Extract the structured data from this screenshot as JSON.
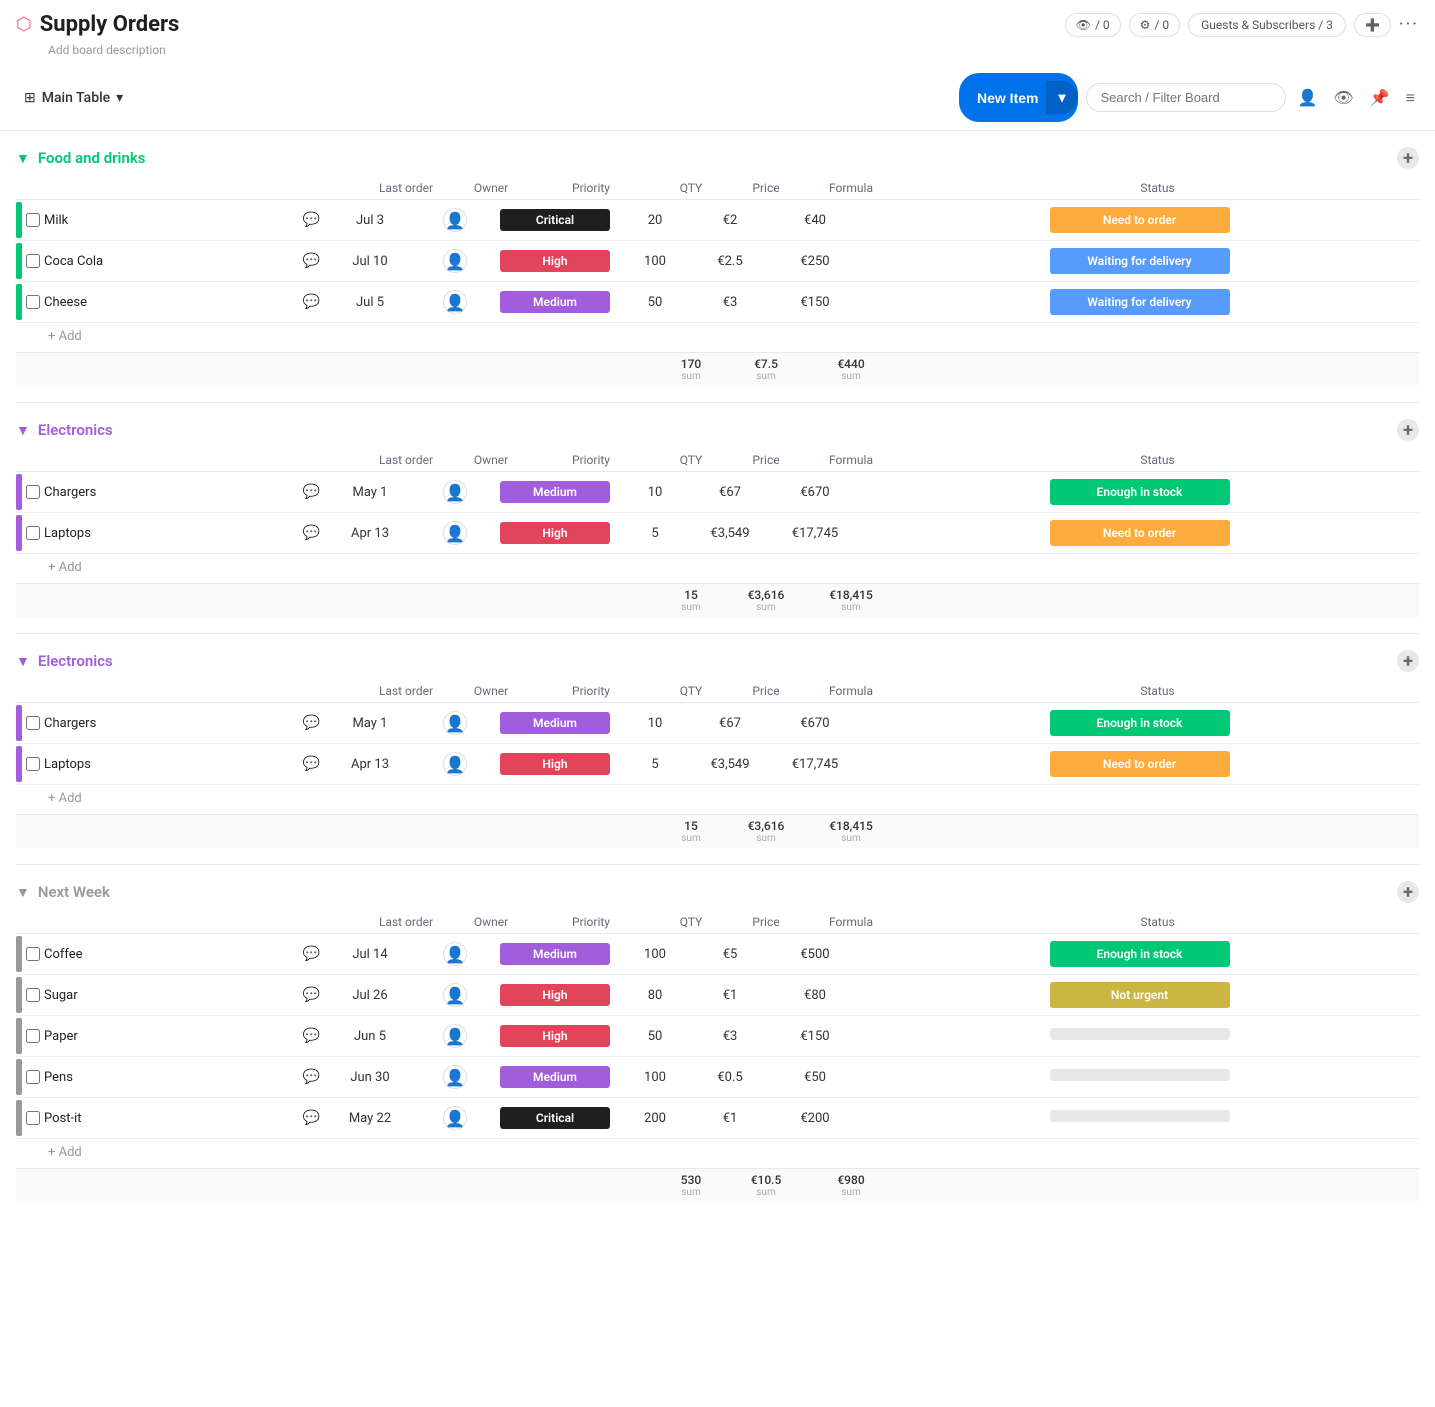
{
  "header": {
    "title": "Supply Orders",
    "description": "Add board description",
    "views_count": "0",
    "automation_count": "0",
    "guests_label": "Guests & Subscribers / 3"
  },
  "toolbar": {
    "main_table_label": "Main Table",
    "new_item_label": "New Item",
    "search_placeholder": "Search / Filter Board"
  },
  "groups": [
    {
      "id": "food",
      "title": "Food and drinks",
      "color": "green",
      "color_hex": "#00c875",
      "collapsed": false,
      "columns": [
        "Last order",
        "Owner",
        "Priority",
        "QTY",
        "Price",
        "Formula",
        "Status"
      ],
      "rows": [
        {
          "name": "Milk",
          "last_order": "Jul 3",
          "priority": "Critical",
          "priority_class": "critical",
          "qty": "20",
          "price": "€2",
          "formula": "€40",
          "status": "Need to order",
          "status_class": "orange"
        },
        {
          "name": "Coca Cola",
          "last_order": "Jul 10",
          "priority": "High",
          "priority_class": "high",
          "qty": "100",
          "price": "€2.5",
          "formula": "€250",
          "status": "Waiting for delivery",
          "status_class": "blue"
        },
        {
          "name": "Cheese",
          "last_order": "Jul 5",
          "priority": "Medium",
          "priority_class": "medium",
          "qty": "50",
          "price": "€3",
          "formula": "€150",
          "status": "Waiting for delivery",
          "status_class": "blue"
        }
      ],
      "summary": {
        "qty": "170",
        "price": "€7.5",
        "formula": "€440"
      }
    },
    {
      "id": "electronics1",
      "title": "Electronics",
      "color": "purple",
      "color_hex": "#a25ddc",
      "collapsed": false,
      "columns": [
        "Last order",
        "Owner",
        "Priority",
        "QTY",
        "Price",
        "Formula",
        "Status"
      ],
      "rows": [
        {
          "name": "Chargers",
          "last_order": "May 1",
          "priority": "Medium",
          "priority_class": "medium",
          "qty": "10",
          "price": "€67",
          "formula": "€670",
          "status": "Enough in stock",
          "status_class": "green"
        },
        {
          "name": "Laptops",
          "last_order": "Apr 13",
          "priority": "High",
          "priority_class": "high",
          "qty": "5",
          "price": "€3,549",
          "formula": "€17,745",
          "status": "Need to order",
          "status_class": "orange"
        }
      ],
      "summary": {
        "qty": "15",
        "price": "€3,616",
        "formula": "€18,415"
      }
    },
    {
      "id": "electronics2",
      "title": "Electronics",
      "color": "purple",
      "color_hex": "#a25ddc",
      "collapsed": false,
      "columns": [
        "Last order",
        "Owner",
        "Priority",
        "QTY",
        "Price",
        "Formula",
        "Status"
      ],
      "rows": [
        {
          "name": "Chargers",
          "last_order": "May 1",
          "priority": "Medium",
          "priority_class": "medium",
          "qty": "10",
          "price": "€67",
          "formula": "€670",
          "status": "Enough in stock",
          "status_class": "green"
        },
        {
          "name": "Laptops",
          "last_order": "Apr 13",
          "priority": "High",
          "priority_class": "high",
          "qty": "5",
          "price": "€3,549",
          "formula": "€17,745",
          "status": "Need to order",
          "status_class": "orange"
        }
      ],
      "summary": {
        "qty": "15",
        "price": "€3,616",
        "formula": "€18,415"
      }
    },
    {
      "id": "nextweek",
      "title": "Next Week",
      "color": "gray",
      "color_hex": "#999",
      "collapsed": false,
      "columns": [
        "Last order",
        "Owner",
        "Priority",
        "QTY",
        "Price",
        "Formula",
        "Status"
      ],
      "rows": [
        {
          "name": "Coffee",
          "last_order": "Jul 14",
          "priority": "Medium",
          "priority_class": "medium",
          "qty": "100",
          "price": "€5",
          "formula": "€500",
          "status": "Enough in stock",
          "status_class": "green"
        },
        {
          "name": "Sugar",
          "last_order": "Jul 26",
          "priority": "High",
          "priority_class": "high",
          "qty": "80",
          "price": "€1",
          "formula": "€80",
          "status": "Not urgent",
          "status_class": "yellow"
        },
        {
          "name": "Paper",
          "last_order": "Jun 5",
          "priority": "High",
          "priority_class": "high",
          "qty": "50",
          "price": "€3",
          "formula": "€150",
          "status": "",
          "status_class": "empty"
        },
        {
          "name": "Pens",
          "last_order": "Jun 30",
          "priority": "Medium",
          "priority_class": "medium",
          "qty": "100",
          "price": "€0.5",
          "formula": "€50",
          "status": "",
          "status_class": "empty"
        },
        {
          "name": "Post-it",
          "last_order": "May 22",
          "priority": "Critical",
          "priority_class": "critical",
          "qty": "200",
          "price": "€1",
          "formula": "€200",
          "status": "",
          "status_class": "empty"
        }
      ],
      "summary": {
        "qty": "530",
        "price": "€10.5",
        "formula": "€980"
      }
    }
  ],
  "labels": {
    "add": "+ Add",
    "sum": "sum"
  }
}
